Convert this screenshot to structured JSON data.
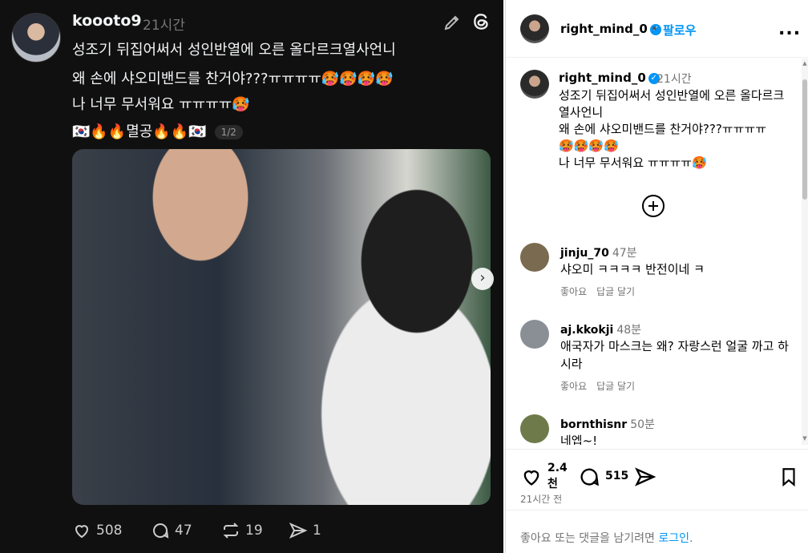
{
  "thread_post": {
    "username": "koooto9",
    "time": "21시간",
    "lines": [
      "성조기 뒤집어써서 성인반열에 오른  올다르크열사언니",
      "왜 손에 샤오미밴드를 찬거야???ㅠㅠㅠㅠ🥵🥵🥵🥵",
      "나 너무 무서워요 ㅠㅠㅠㅠ🥵",
      "🇰🇷🔥🔥멸공🔥🔥🇰🇷"
    ],
    "pager": "1/2",
    "likes": "508",
    "replies": "47",
    "reposts": "19",
    "shares": "1"
  },
  "insta_panel": {
    "header_username": "right_mind_0",
    "header_dot": "•",
    "follow_label": "팔로우",
    "more_label": "...",
    "caption": {
      "username": "right_mind_0",
      "time": "21시간",
      "text": "성조기 뒤집어써서 성인반열에 오른 올다르크열사언니\n왜 손에 샤오미밴드를 찬거야???ㅠㅠㅠㅠ\n🥵🥵🥵🥵\n나 너무 무서워요 ㅠㅠㅠㅠ🥵"
    },
    "comments": [
      {
        "username": "jinju_70",
        "time": "47분",
        "text": "샤오미 ㅋㅋㅋㅋ 반전이네 ㅋ",
        "like_label": "좋아요",
        "reply_label": "답글 달기",
        "avatar_color": "#7a6a4f"
      },
      {
        "username": "aj.kkokji",
        "time": "48분",
        "text": "애국자가 마스크는 왜? 자랑스런 얼굴 까고 하시라",
        "like_label": "좋아요",
        "reply_label": "답글 달기",
        "avatar_color": "#8a8f96"
      },
      {
        "username": "bornthisnr",
        "time": "50분",
        "text": "네엡~!",
        "avatar_color": "#6e7a4a"
      }
    ],
    "like_count": "2.4천",
    "comment_count": "515",
    "post_time": "21시간 전",
    "footer_text": "좋아요 또는 댓글을 남기려면 ",
    "login_label": "로그인",
    "footer_end": "."
  },
  "colors": {
    "threads_bg": "#101010",
    "instagram_blue": "#0095f6",
    "muted": "#737373"
  }
}
